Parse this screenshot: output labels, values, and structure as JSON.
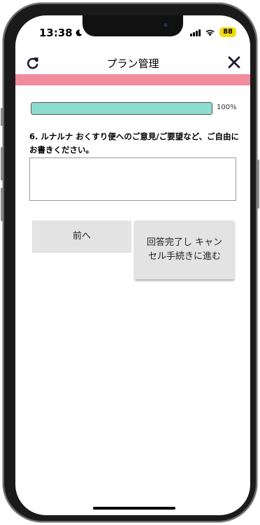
{
  "status_bar": {
    "time": "13:38",
    "battery": "88"
  },
  "nav": {
    "title": "プラン管理"
  },
  "progress": {
    "value_percent": 100,
    "label": "100%"
  },
  "survey": {
    "question": "6. ルナルナ おくすり便へのご意見/ご要望など、ご自由にお書きください。",
    "answer_value": "",
    "answer_placeholder": ""
  },
  "buttons": {
    "prev_label": "前へ",
    "next_label": "回答完了し キャンセル手続きに進む"
  },
  "colors": {
    "header_bar": "#f08c9c",
    "progress_fill": "#8cdcd2",
    "button_bg": "#e3e3e3"
  },
  "icons": {
    "refresh": "refresh-icon",
    "close": "close-icon"
  }
}
